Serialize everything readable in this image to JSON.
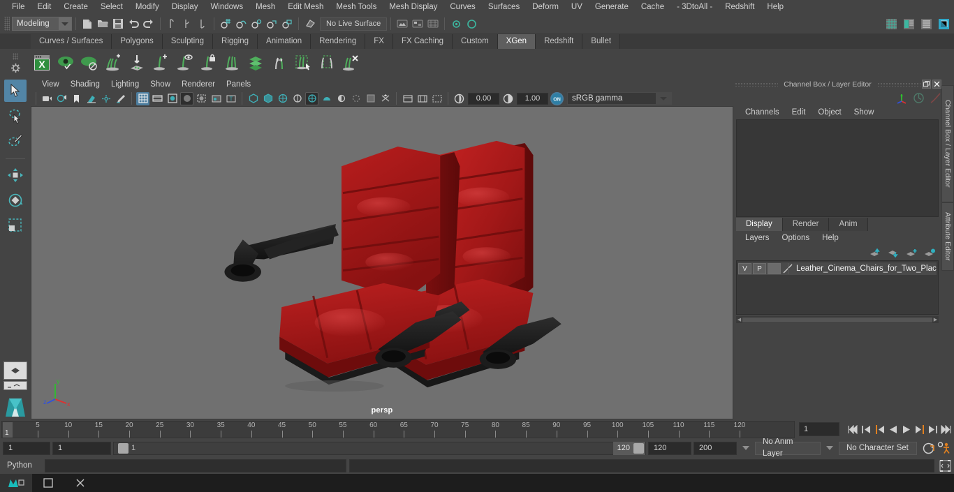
{
  "app": {
    "title": "Autodesk Maya",
    "mode": "Modeling"
  },
  "menubar": {
    "items": [
      {
        "label": "File"
      },
      {
        "label": "Edit"
      },
      {
        "label": "Create"
      },
      {
        "label": "Select"
      },
      {
        "label": "Modify"
      },
      {
        "label": "Display"
      },
      {
        "label": "Windows"
      },
      {
        "label": "Mesh"
      },
      {
        "label": "Edit Mesh"
      },
      {
        "label": "Mesh Tools"
      },
      {
        "label": "Mesh Display"
      },
      {
        "label": "Curves"
      },
      {
        "label": "Surfaces"
      },
      {
        "label": "Deform"
      },
      {
        "label": "UV"
      },
      {
        "label": "Generate"
      },
      {
        "label": "Cache"
      },
      {
        "label": "- 3DtoAll -"
      },
      {
        "label": "Redshift"
      },
      {
        "label": "Help"
      }
    ]
  },
  "statusbar": {
    "mode_label": "Modeling",
    "live_surface_label": "No Live Surface",
    "icons": [
      "new-scene-icon",
      "open-scene-icon",
      "save-scene-icon",
      "undo-icon",
      "redo-icon",
      "select-by-hierarchy-icon",
      "select-by-object-icon",
      "select-by-component-icon",
      "snap-to-grid-icon",
      "snap-to-curve-icon",
      "snap-to-point-icon",
      "snap-to-projected-center-icon",
      "snap-to-view-plane-icon",
      "make-live-icon",
      "render-current-frame-icon",
      "ipr-render-icon",
      "render-settings-icon"
    ],
    "right_icons": [
      "show-hide-modeling-toolkit-icon",
      "show-hide-attribute-editor-icon",
      "show-hide-tool-settings-icon",
      "show-hide-channel-box-icon"
    ]
  },
  "shelf": {
    "tabs": [
      {
        "label": "Curves / Surfaces",
        "active": false
      },
      {
        "label": "Polygons",
        "active": false
      },
      {
        "label": "Sculpting",
        "active": false
      },
      {
        "label": "Rigging",
        "active": false
      },
      {
        "label": "Animation",
        "active": false
      },
      {
        "label": "Rendering",
        "active": false
      },
      {
        "label": "FX",
        "active": false
      },
      {
        "label": "FX Caching",
        "active": false
      },
      {
        "label": "Custom",
        "active": false
      },
      {
        "label": "XGen",
        "active": true
      },
      {
        "label": "Redshift",
        "active": false
      },
      {
        "label": "Bullet",
        "active": false
      }
    ],
    "icons": [
      "xgen-editor-icon",
      "xgen-preview-icon",
      "xgen-disable-preview-icon",
      "xgen-add-guides-icon",
      "xgen-place-guides-icon",
      "xgen-add-grooming-icon",
      "xgen-preview-groomable-icon",
      "xgen-lock-icon",
      "xgen-comb-icon",
      "xgen-density-icon",
      "xgen-length-icon",
      "xgen-select-region-icon",
      "xgen-mask-icon",
      "xgen-clear-icon"
    ]
  },
  "toolbox": {
    "tools": [
      {
        "name": "select-tool",
        "active": true
      },
      {
        "name": "lasso-select-tool",
        "active": false
      },
      {
        "name": "paint-select-tool",
        "active": false
      },
      {
        "name": "move-tool",
        "active": false
      },
      {
        "name": "rotate-tool",
        "active": false
      },
      {
        "name": "scale-tool",
        "active": false
      }
    ],
    "layout_icons": [
      "single-perspective-view-icon",
      "four-view-layout-icon",
      "persp-outliner-layout-icon"
    ]
  },
  "viewport": {
    "menus": [
      {
        "label": "View"
      },
      {
        "label": "Shading"
      },
      {
        "label": "Lighting"
      },
      {
        "label": "Show"
      },
      {
        "label": "Renderer"
      },
      {
        "label": "Panels"
      }
    ],
    "camera_label": "persp",
    "exposure": "0.00",
    "gamma": "1.00",
    "color_management_toggle": "ON",
    "view_transform": "sRGB gamma",
    "background_color": "#707070",
    "model": {
      "name": "Leather Cinema Chairs for Two",
      "leather_color": "#a81c1c",
      "leather_shadow": "#6e1111",
      "trim_color": "#1a1a1a"
    },
    "axis": {
      "x": "x",
      "y": "y",
      "z": "z",
      "x_color": "#e03030",
      "y_color": "#2fbf2f",
      "z_color": "#3050e0"
    }
  },
  "channelbox": {
    "title": "Channel Box / Layer Editor",
    "menus": [
      {
        "label": "Channels"
      },
      {
        "label": "Edit"
      },
      {
        "label": "Object"
      },
      {
        "label": "Show"
      }
    ],
    "window_buttons": [
      "undock-icon",
      "close-icon"
    ],
    "toolbar_icons": [
      "manipulator-icon",
      "quick-rig-icon",
      "curve-icon"
    ]
  },
  "layereditor": {
    "tabs": [
      {
        "label": "Display",
        "active": true
      },
      {
        "label": "Render",
        "active": false
      },
      {
        "label": "Anim",
        "active": false
      }
    ],
    "menus": [
      {
        "label": "Layers"
      },
      {
        "label": "Options"
      },
      {
        "label": "Help"
      }
    ],
    "buttons": [
      "move-layer-up-icon",
      "move-layer-down-icon",
      "new-layer-icon",
      "new-layer-from-selected-icon"
    ],
    "layers": [
      {
        "visibility": "V",
        "playback": "P",
        "shading": "",
        "name": "Leather_Cinema_Chairs_for_Two_Plac"
      }
    ]
  },
  "sidetabs": [
    {
      "label": "Channel Box / Layer Editor"
    },
    {
      "label": "Attribute Editor"
    }
  ],
  "timeslider": {
    "start": 1,
    "end": 120,
    "current_frame": "1",
    "tick_step": 5,
    "labels": [
      5,
      10,
      15,
      20,
      25,
      30,
      35,
      40,
      45,
      50,
      55,
      60,
      65,
      70,
      75,
      80,
      85,
      90,
      95,
      100,
      105,
      110,
      115,
      120
    ],
    "playback_buttons": [
      "go-to-start-icon",
      "step-back-frame-icon",
      "step-back-key-icon",
      "play-backwards-icon",
      "play-forwards-icon",
      "step-forward-key-icon",
      "step-forward-frame-icon",
      "go-to-end-icon"
    ]
  },
  "rangeslider": {
    "anim_start": "1",
    "range_start": "1",
    "slider_start_label": "1",
    "slider_end_label": "120",
    "range_end": "120",
    "anim_end": "200",
    "anim_layer": "No Anim Layer",
    "character_set": "No Character Set",
    "right_icons": [
      "auto-keyframe-icon",
      "animation-preferences-icon"
    ],
    "accent_color": "#e08020"
  },
  "commandline": {
    "language": "Python",
    "input_value": "",
    "output_value": "",
    "script-editor-button": "script-editor-icon"
  },
  "taskbar": {
    "items": [
      {
        "name": "maya-app-icon",
        "selected": true
      },
      {
        "name": "window-icon",
        "selected": false
      },
      {
        "name": "close-icon",
        "selected": false
      }
    ]
  }
}
